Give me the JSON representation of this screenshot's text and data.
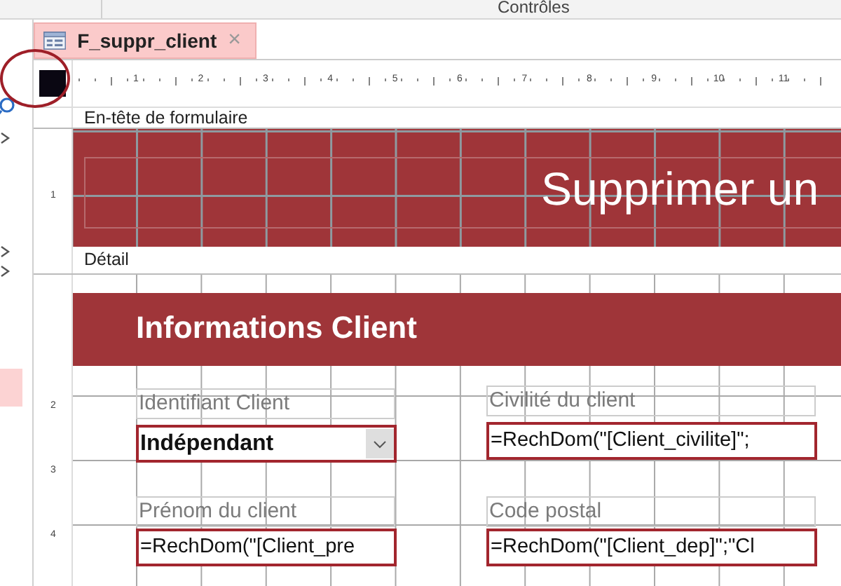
{
  "ribbon": {
    "group_label": "Contrôles"
  },
  "tab": {
    "label": "F_suppr_client",
    "close": "×",
    "selected": true
  },
  "ruler": {
    "marks": [
      "1",
      "2",
      "3",
      "4",
      "5",
      "6",
      "7",
      "8",
      "9",
      "10",
      "11"
    ]
  },
  "form_header": {
    "bar_label": "En-tête de formulaire",
    "ruler_marks": [
      "1"
    ],
    "title": "Supprimer un"
  },
  "detail": {
    "bar_label": "Détail",
    "ruler_marks": [
      "2",
      "3",
      "4"
    ],
    "band_title": "Informations Client",
    "controls": [
      {
        "kind": "combo",
        "label": "Identifiant Client",
        "value": "Indépendant"
      },
      {
        "kind": "text",
        "label": "Civilité du client",
        "value": "=RechDom(\"[Client_civilite]\";"
      },
      {
        "kind": "text",
        "label": "Prénom du client",
        "value": "=RechDom(\"[Client_pre"
      },
      {
        "kind": "text",
        "label": "Code postal",
        "value": "=RechDom(\"[Client_dep]\";\"Cl"
      }
    ]
  }
}
